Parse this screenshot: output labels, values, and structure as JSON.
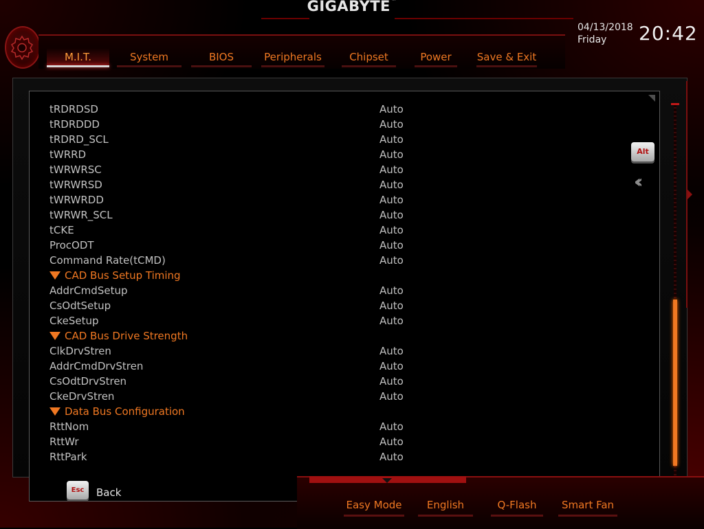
{
  "brand": {
    "name": "GIGABYTE",
    "tm": "™"
  },
  "clock": {
    "date": "04/13/2018",
    "day": "Friday",
    "time": "20:42"
  },
  "tabs": [
    {
      "label": "M.I.T.",
      "active": true
    },
    {
      "label": "System",
      "active": false
    },
    {
      "label": "BIOS",
      "active": false
    },
    {
      "label": "Peripherals",
      "active": false
    },
    {
      "label": "Chipset",
      "active": false
    },
    {
      "label": "Power",
      "active": false
    },
    {
      "label": "Save & Exit",
      "active": false
    }
  ],
  "settings": [
    {
      "type": "item",
      "label": "tRDRDSD",
      "value": "Auto"
    },
    {
      "type": "item",
      "label": "tRDRDDD",
      "value": "Auto"
    },
    {
      "type": "item",
      "label": "tRDRD_SCL",
      "value": "Auto"
    },
    {
      "type": "item",
      "label": "tWRRD",
      "value": "Auto"
    },
    {
      "type": "item",
      "label": "tWRWRSC",
      "value": "Auto"
    },
    {
      "type": "item",
      "label": "tWRWRSD",
      "value": "Auto"
    },
    {
      "type": "item",
      "label": "tWRWRDD",
      "value": "Auto"
    },
    {
      "type": "item",
      "label": "tWRWR_SCL",
      "value": "Auto"
    },
    {
      "type": "item",
      "label": "tCKE",
      "value": "Auto"
    },
    {
      "type": "item",
      "label": "ProcODT",
      "value": "Auto"
    },
    {
      "type": "item",
      "label": "Command Rate(tCMD)",
      "value": "Auto"
    },
    {
      "type": "section",
      "label": "CAD Bus Setup Timing"
    },
    {
      "type": "item",
      "label": "AddrCmdSetup",
      "value": "Auto"
    },
    {
      "type": "item",
      "label": "CsOdtSetup",
      "value": "Auto"
    },
    {
      "type": "item",
      "label": "CkeSetup",
      "value": "Auto"
    },
    {
      "type": "section",
      "label": "CAD Bus Drive Strength"
    },
    {
      "type": "item",
      "label": "ClkDrvStren",
      "value": "Auto"
    },
    {
      "type": "item",
      "label": "AddrCmdDrvStren",
      "value": "Auto"
    },
    {
      "type": "item",
      "label": "CsOdtDrvStren",
      "value": "Auto"
    },
    {
      "type": "item",
      "label": "CkeDrvStren",
      "value": "Auto"
    },
    {
      "type": "section",
      "label": "Data Bus Configuration"
    },
    {
      "type": "item",
      "label": "RttNom",
      "value": "Auto"
    },
    {
      "type": "item",
      "label": "RttWr",
      "value": "Auto"
    },
    {
      "type": "item",
      "label": "RttPark",
      "value": "Auto"
    }
  ],
  "keys": {
    "alt": "Alt",
    "esc": "Esc",
    "back": "Back"
  },
  "footer": [
    "Easy Mode",
    "English",
    "Q-Flash",
    "Smart Fan"
  ],
  "scrollbar": {
    "thumb_start_fraction": 0.52,
    "thumb_end_fraction": 0.96
  },
  "colors": {
    "accent": "#f07822",
    "frame_red": "#a01010",
    "text": "#c2c2c2"
  },
  "icons": [
    "gear-icon",
    "collapse-chevron-icon"
  ]
}
